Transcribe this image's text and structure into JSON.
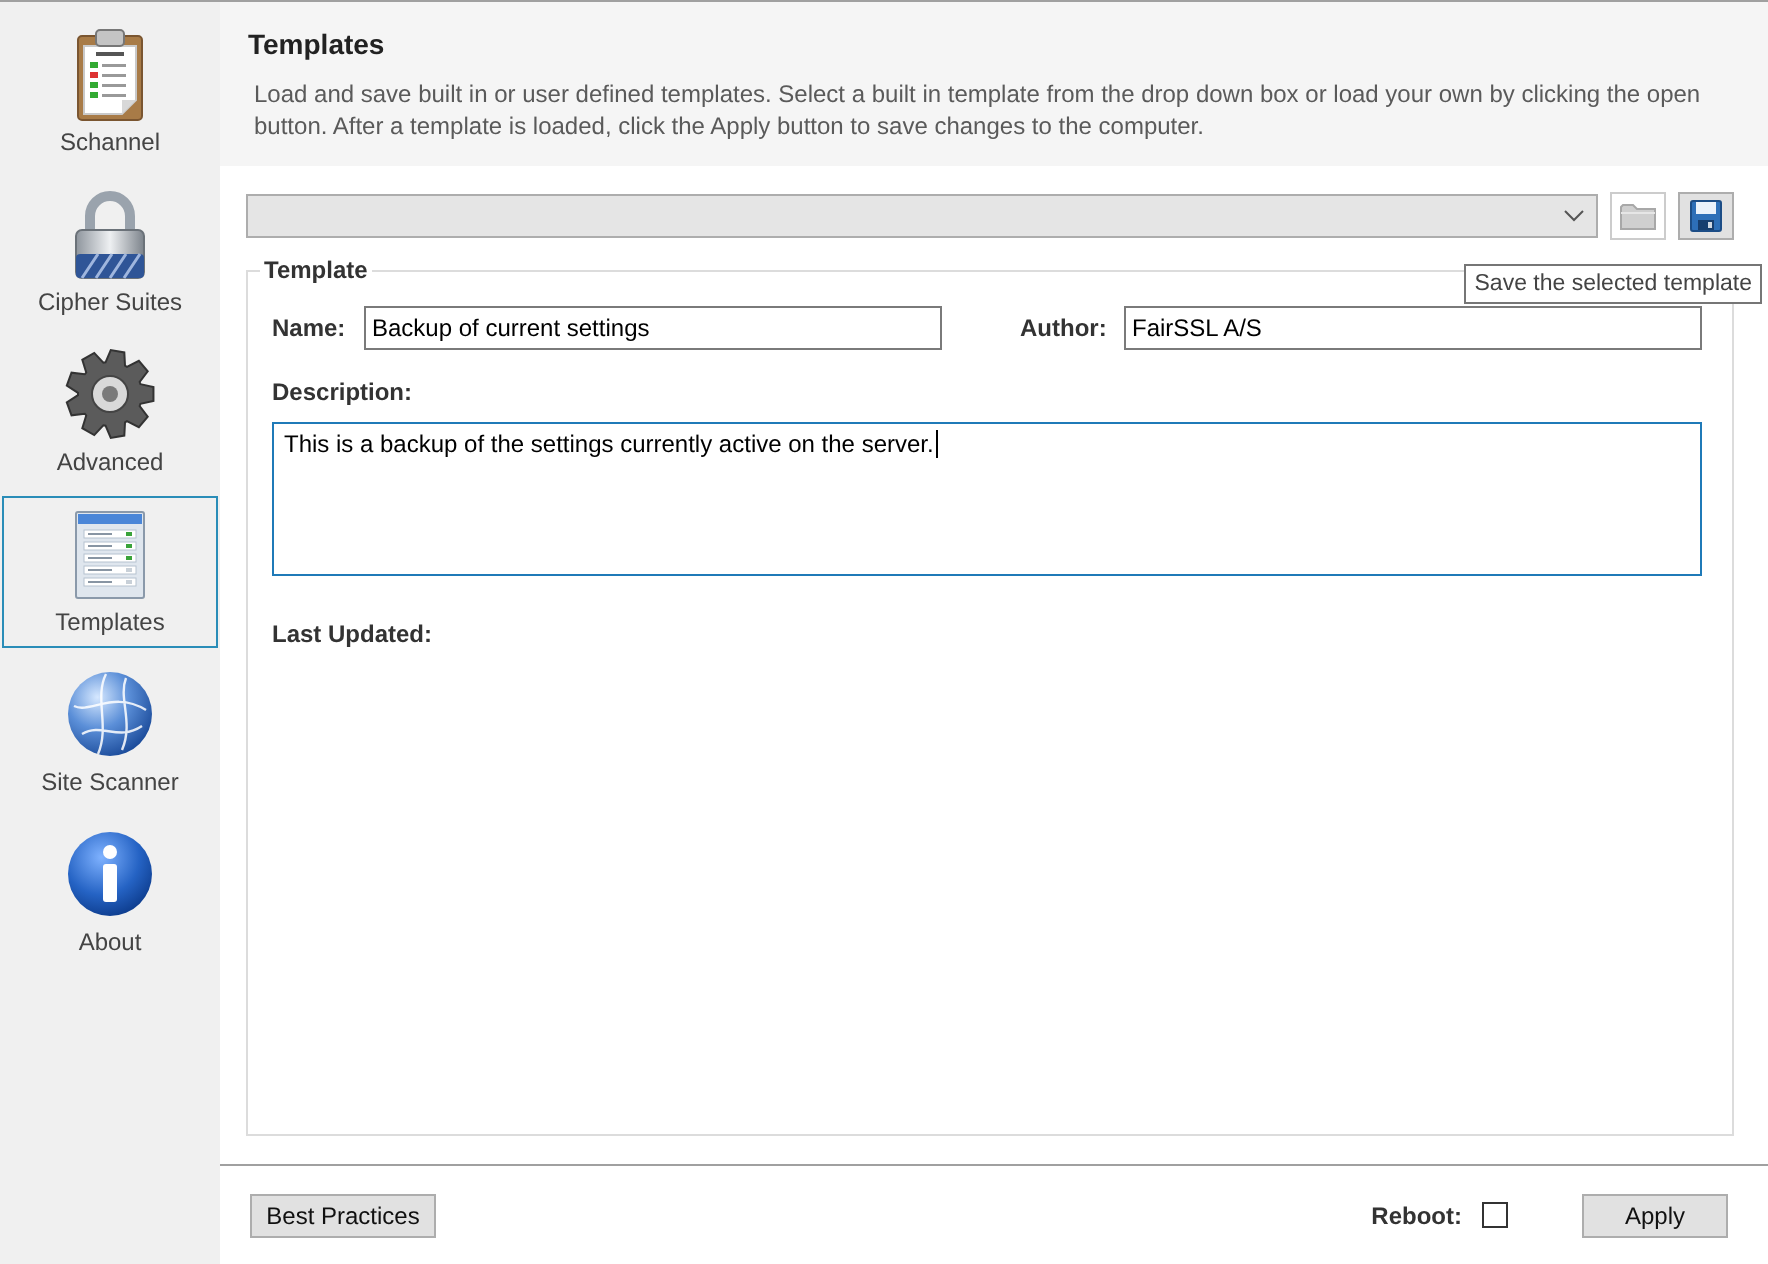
{
  "sidebar": {
    "items": [
      {
        "kind": "clipboard",
        "label": "Schannel",
        "selected": false
      },
      {
        "kind": "padlock",
        "label": "Cipher Suites",
        "selected": false
      },
      {
        "kind": "gear",
        "label": "Advanced",
        "selected": false
      },
      {
        "kind": "list",
        "label": "Templates",
        "selected": true
      },
      {
        "kind": "globe",
        "label": "Site Scanner",
        "selected": false
      },
      {
        "kind": "info",
        "label": "About",
        "selected": false
      }
    ]
  },
  "header": {
    "title": "Templates",
    "description": "Load and save built in or user defined templates. Select a built in template from the drop down box or load your own by clicking the open button. After a template is loaded, click the Apply button to save changes to the computer."
  },
  "toolbar": {
    "buttons": [
      {
        "kind": "open",
        "disabled": true
      },
      {
        "kind": "save",
        "disabled": false
      }
    ],
    "tooltip": "Save the selected template"
  },
  "template": {
    "legend": "Template",
    "name": {
      "label": "Name:",
      "value": "Backup of current settings"
    },
    "author": {
      "label": "Author:",
      "value": "FairSSL A/S"
    },
    "description": {
      "label": "Description:",
      "value": "This is a backup of the settings currently active on the server.",
      "focused": true
    },
    "last_updated": {
      "label": "Last Updated:"
    }
  },
  "footer": {
    "best_practices": "Best Practices",
    "reboot": {
      "label": "Reboot:",
      "checked": false
    },
    "apply": "Apply"
  }
}
